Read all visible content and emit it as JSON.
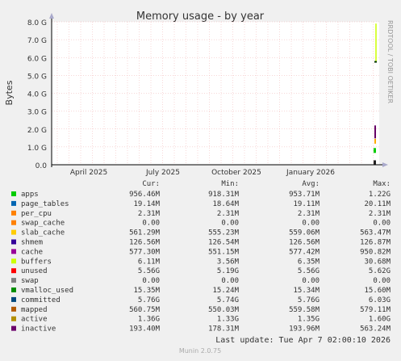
{
  "chart_data": {
    "type": "area",
    "title": "Memory usage - by year",
    "ylabel": "Bytes",
    "side_label": "RRDTOOL / TOBI OETIKER",
    "ylim": [
      0,
      8.0
    ],
    "y_unit": "G",
    "y_ticks": [
      "0.0",
      "1.0 G",
      "2.0 G",
      "3.0 G",
      "4.0 G",
      "5.0 G",
      "6.0 G",
      "7.0 G",
      "8.0 G"
    ],
    "x_ticks": [
      "April 2025",
      "July 2025",
      "October 2025",
      "January 2026"
    ],
    "legend_headers": [
      "Cur:",
      "Min:",
      "Avg:",
      "Max:"
    ],
    "series": [
      {
        "name": "apps",
        "color": "#00cc00",
        "cur": "956.46M",
        "min": "918.31M",
        "avg": "953.71M",
        "max": "1.22G"
      },
      {
        "name": "page_tables",
        "color": "#0066b3",
        "cur": "19.14M",
        "min": "18.64M",
        "avg": "19.11M",
        "max": "20.11M"
      },
      {
        "name": "per_cpu",
        "color": "#ff8000",
        "cur": "2.31M",
        "min": "2.31M",
        "avg": "2.31M",
        "max": "2.31M"
      },
      {
        "name": "swap_cache",
        "color": "#ff8000",
        "cur": "0.00",
        "min": "0.00",
        "avg": "0.00",
        "max": "0.00"
      },
      {
        "name": "slab_cache",
        "color": "#ffcc00",
        "cur": "561.29M",
        "min": "555.23M",
        "avg": "559.06M",
        "max": "563.47M"
      },
      {
        "name": "shmem",
        "color": "#330099",
        "cur": "126.56M",
        "min": "126.54M",
        "avg": "126.56M",
        "max": "126.87M"
      },
      {
        "name": "cache",
        "color": "#990099",
        "cur": "577.30M",
        "min": "551.15M",
        "avg": "577.42M",
        "max": "950.82M"
      },
      {
        "name": "buffers",
        "color": "#ccff00",
        "cur": "6.11M",
        "min": "3.56M",
        "avg": "6.35M",
        "max": "30.68M"
      },
      {
        "name": "unused",
        "color": "#ff0000",
        "cur": "5.56G",
        "min": "5.19G",
        "avg": "5.56G",
        "max": "5.62G"
      },
      {
        "name": "swap",
        "color": "#808080",
        "cur": "0.00",
        "min": "0.00",
        "avg": "0.00",
        "max": "0.00"
      },
      {
        "name": "vmalloc_used",
        "color": "#008f00",
        "cur": "15.35M",
        "min": "15.24M",
        "avg": "15.34M",
        "max": "15.60M"
      },
      {
        "name": "committed",
        "color": "#00487d",
        "cur": "5.76G",
        "min": "5.74G",
        "avg": "5.76G",
        "max": "6.03G"
      },
      {
        "name": "mapped",
        "color": "#b35a00",
        "cur": "560.75M",
        "min": "550.03M",
        "avg": "559.58M",
        "max": "579.11M"
      },
      {
        "name": "active",
        "color": "#b38f00",
        "cur": "1.36G",
        "min": "1.33G",
        "avg": "1.35G",
        "max": "1.60G"
      },
      {
        "name": "inactive",
        "color": "#6b006b",
        "cur": "193.40M",
        "min": "178.31M",
        "avg": "193.96M",
        "max": "563.24M"
      }
    ],
    "swatch_colors_visible": [
      "#00cc00",
      "#0066b3",
      "#ff8000",
      "#ffcc00",
      "#330099",
      "#990099",
      "#ccff00",
      "#ff0000",
      "#808080",
      "#008f00",
      "#00487d",
      "#b35a00",
      "#b38f00",
      "#6b006b"
    ],
    "last_update": "Last update:  Tue Apr  7 02:00:10 2026",
    "footer": "Munin 2.0.75"
  }
}
